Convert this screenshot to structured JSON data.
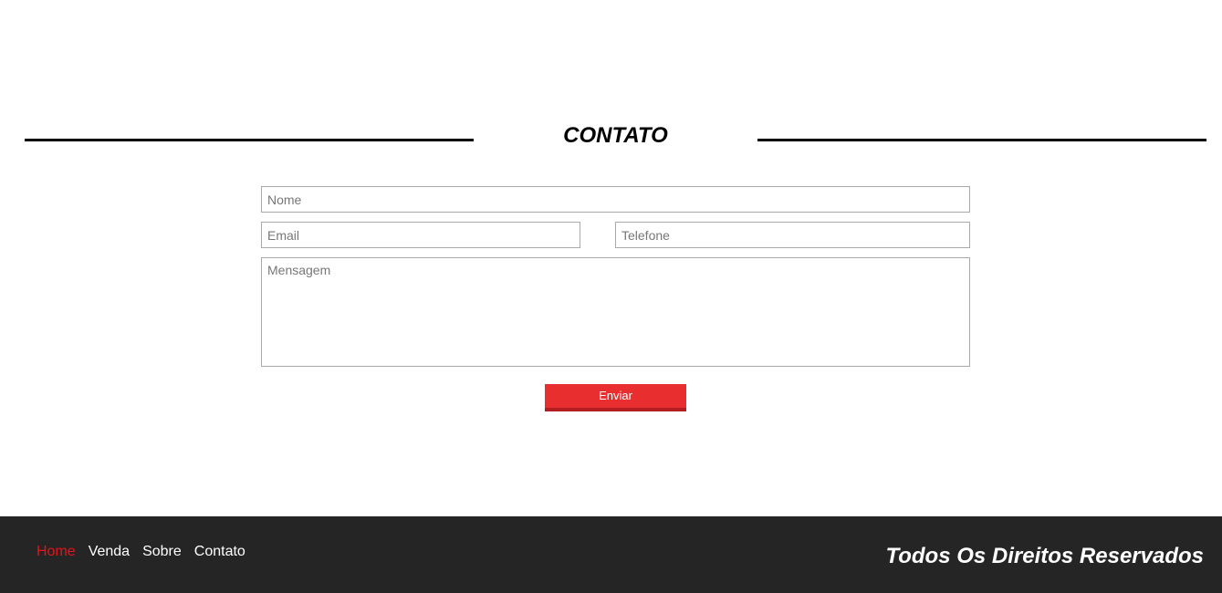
{
  "section": {
    "title": "CONTATO"
  },
  "form": {
    "name_placeholder": "Nome",
    "email_placeholder": "Email",
    "phone_placeholder": "Telefone",
    "message_placeholder": "Mensagem",
    "submit_label": "Enviar"
  },
  "footer": {
    "nav": [
      {
        "label": "Home",
        "active": true
      },
      {
        "label": "Venda",
        "active": false
      },
      {
        "label": "Sobre",
        "active": false
      },
      {
        "label": "Contato",
        "active": false
      }
    ],
    "copyright": "Todos Os Direitos Reservados"
  },
  "colors": {
    "accent": "#e92e30",
    "accent_dark": "#b21d20",
    "footer_bg": "#252525",
    "active_link": "#e0161a"
  }
}
